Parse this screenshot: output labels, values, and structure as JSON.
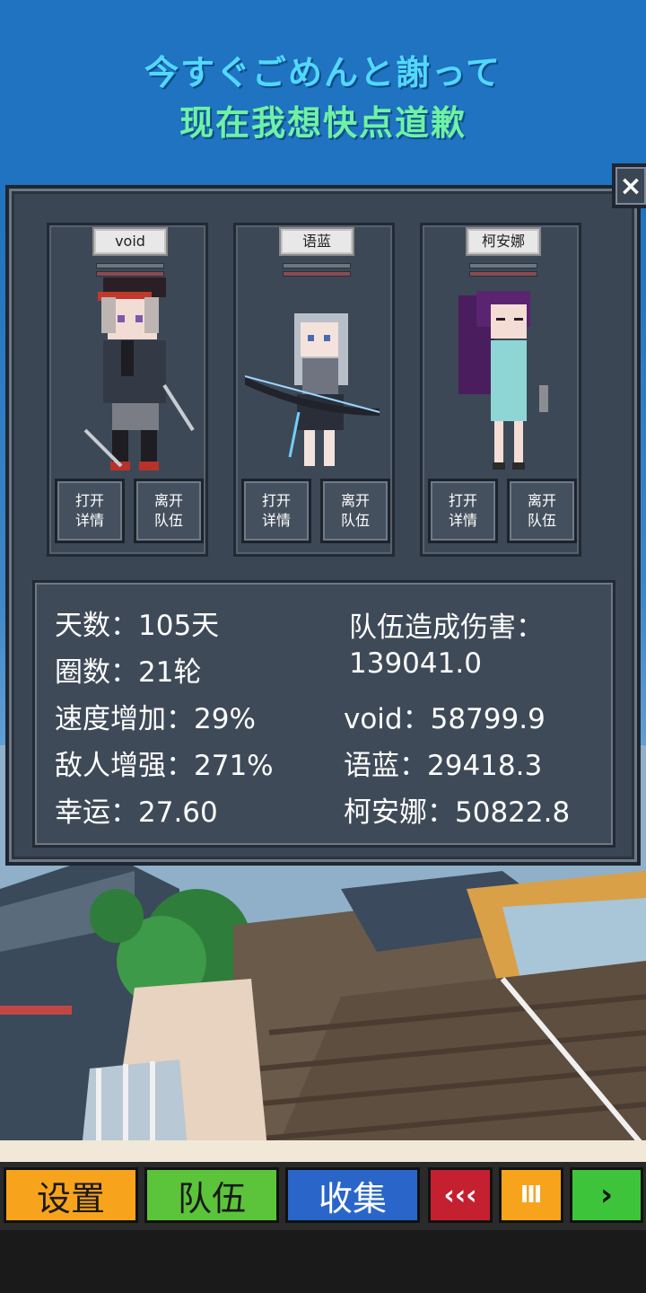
{
  "banner": {
    "line1": "今すぐごめんと謝って",
    "line2": "现在我想快点道歉"
  },
  "panel": {
    "close_label": "×",
    "members": [
      {
        "name": "void",
        "open_label_1": "打开",
        "open_label_2": "详情",
        "leave_label_1": "离开",
        "leave_label_2": "队伍"
      },
      {
        "name": "语蓝",
        "open_label_1": "打开",
        "open_label_2": "详情",
        "leave_label_1": "离开",
        "leave_label_2": "队伍"
      },
      {
        "name": "柯安娜",
        "open_label_1": "打开",
        "open_label_2": "详情",
        "leave_label_1": "离开",
        "leave_label_2": "队伍"
      }
    ],
    "stats": {
      "days": "天数：105天",
      "laps": "圈数：21轮",
      "speed": "速度增加：29%",
      "enemy": "敌人增强：271%",
      "luck": "幸运：27.60",
      "damage_title": "队伍造成伤害：",
      "damage_total": "139041.0",
      "damage_void": "void：58799.9",
      "damage_yulan": "语蓝：29418.3",
      "damage_keanna": "柯安娜：50822.8"
    }
  },
  "bottom_bar": {
    "settings": "设置",
    "team": "队伍",
    "collection": "收集",
    "rewind": "‹‹‹",
    "pause": "Ⅲ",
    "forward": "›"
  },
  "colors": {
    "banner_bg": "#1f73c0",
    "line1": "#52d8ff",
    "line2": "#6ef2a6",
    "settings_btn": "#f7a31c",
    "team_btn": "#5cc43a",
    "collection_btn": "#2a66c9",
    "rewind_btn": "#c42030",
    "pause_btn": "#f7a31c",
    "forward_btn": "#3ec43a"
  }
}
